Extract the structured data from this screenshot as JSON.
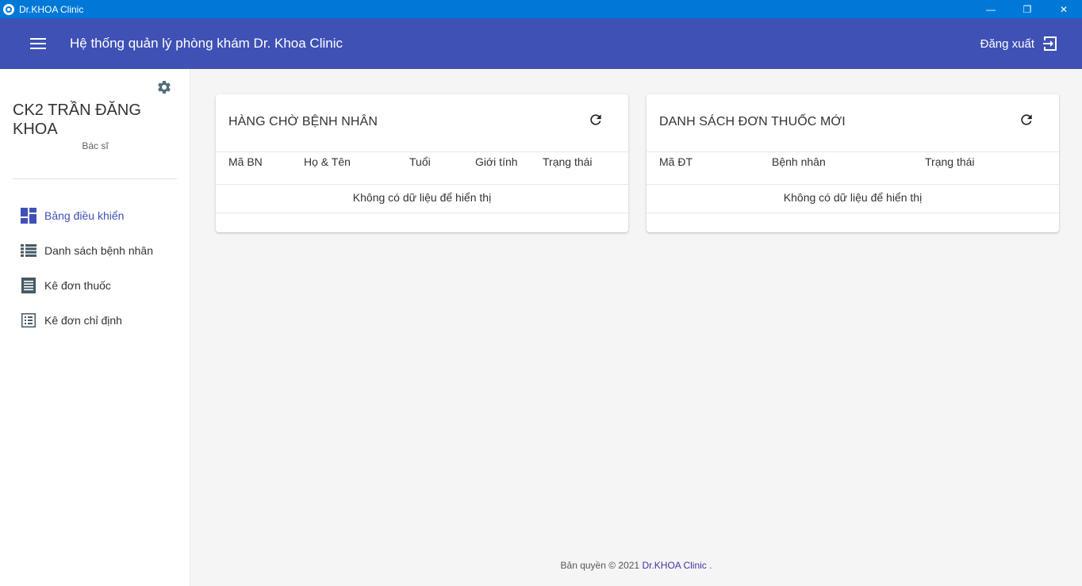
{
  "window": {
    "title": "Dr.KHOA Clinic",
    "minimize": "—",
    "restore": "❐",
    "close": "✕"
  },
  "header": {
    "title": "Hệ thống quản lý phòng khám Dr. Khoa Clinic",
    "logout_label": "Đăng xuất",
    "color": "#3f51b5"
  },
  "sidebar": {
    "user_name": "CK2 TRẦN ĐĂNG KHOA",
    "user_role": "Bác sĩ",
    "items": [
      {
        "label": "Bảng điều khiển",
        "icon": "dashboard-icon",
        "active": true
      },
      {
        "label": "Danh sách bệnh nhân",
        "icon": "list-icon",
        "active": false
      },
      {
        "label": "Kê đơn thuốc",
        "icon": "receipt-icon",
        "active": false
      },
      {
        "label": "Kê đơn chỉ định",
        "icon": "checklist-icon",
        "active": false
      }
    ]
  },
  "queue_card": {
    "title": "HÀNG CHỜ BỆNH NHÂN",
    "columns": [
      "Mã BN",
      "Họ & Tên",
      "Tuổi",
      "Giới tính",
      "Trạng thái"
    ],
    "empty_text": "Không có dữ liệu để hiển thị"
  },
  "prescription_card": {
    "title": "DANH SÁCH ĐƠN THUỐC MỚI",
    "columns": [
      "Mã ĐT",
      "Bệnh nhân",
      "Trạng thái"
    ],
    "empty_text": "Không có dữ liệu để hiển thị"
  },
  "footer": {
    "prefix": "Bản quyền © 2021 ",
    "brand": "Dr.KHOA Clinic",
    "suffix": " ."
  }
}
